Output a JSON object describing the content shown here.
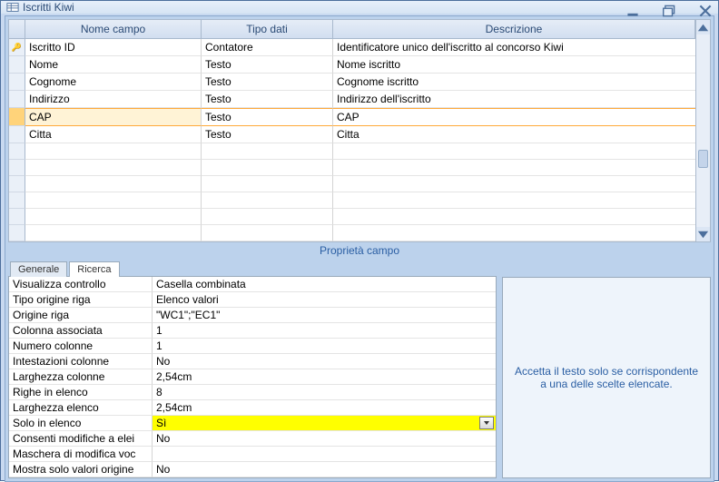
{
  "window": {
    "title": "Iscritti Kiwi"
  },
  "grid": {
    "columns": {
      "name": "Nome campo",
      "type": "Tipo dati",
      "desc": "Descrizione"
    },
    "rows": [
      {
        "key": true,
        "name": "Iscritto ID",
        "type": "Contatore",
        "desc": "Identificatore unico dell'iscritto al concorso Kiwi"
      },
      {
        "key": false,
        "name": "Nome",
        "type": "Testo",
        "desc": "Nome iscritto"
      },
      {
        "key": false,
        "name": "Cognome",
        "type": "Testo",
        "desc": "Cognome iscritto"
      },
      {
        "key": false,
        "name": "Indirizzo",
        "type": "Testo",
        "desc": "Indirizzo dell'iscritto"
      },
      {
        "key": false,
        "name": "CAP",
        "type": "Testo",
        "desc": "CAP",
        "selected": true
      },
      {
        "key": false,
        "name": "Citta",
        "type": "Testo",
        "desc": "Citta"
      }
    ],
    "blank_rows": 6
  },
  "section_label": "Proprietà campo",
  "tabs": {
    "general": "Generale",
    "lookup": "Ricerca"
  },
  "properties": [
    {
      "label": "Visualizza controllo",
      "value": "Casella combinata"
    },
    {
      "label": "Tipo origine riga",
      "value": "Elenco valori"
    },
    {
      "label": "Origine riga",
      "value": "\"WC1\";\"EC1\""
    },
    {
      "label": "Colonna associata",
      "value": "1"
    },
    {
      "label": "Numero colonne",
      "value": "1"
    },
    {
      "label": "Intestazioni colonne",
      "value": "No"
    },
    {
      "label": "Larghezza colonne",
      "value": "2,54cm"
    },
    {
      "label": "Righe in elenco",
      "value": "8"
    },
    {
      "label": "Larghezza elenco",
      "value": "2,54cm"
    },
    {
      "label": "Solo in elenco",
      "value": "Sì",
      "highlight": true,
      "dropdown": true
    },
    {
      "label": "Consenti modifiche a elenco",
      "label_trunc": "Consenti modifiche a elei",
      "value": "No"
    },
    {
      "label": "Maschera di modifica voci",
      "label_trunc": "Maschera di modifica voc",
      "value": ""
    },
    {
      "label": "Mostra solo valori origine",
      "label_trunc": "Mostra solo valori origine",
      "value": "No"
    }
  ],
  "help_text": "Accetta il testo solo se corrispondente a una delle scelte elencate."
}
